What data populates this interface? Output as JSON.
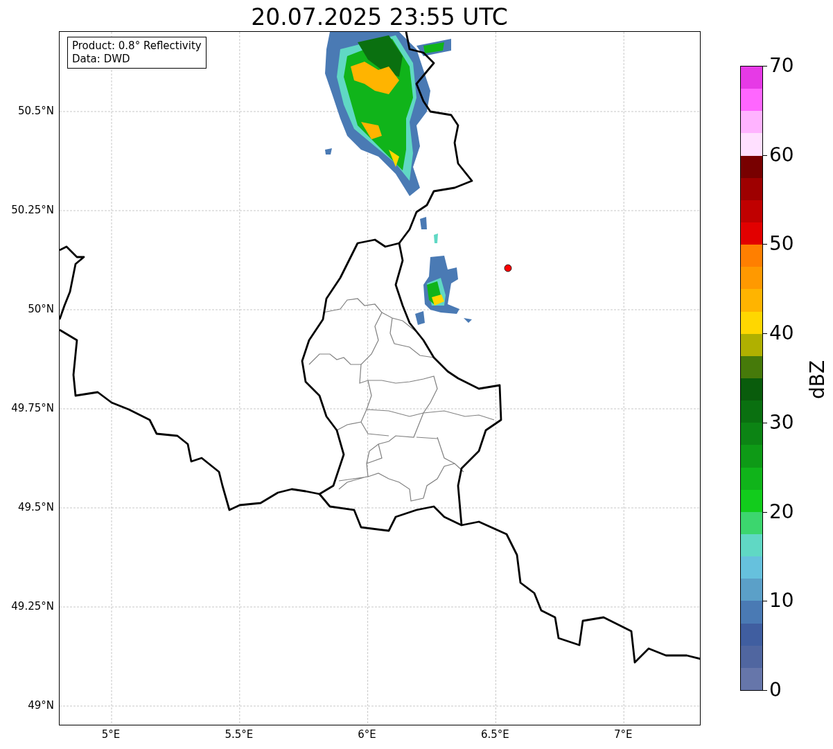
{
  "title": "20.07.2025 23:55 UTC",
  "info_box": [
    "Product: 0.8° Reflectivity",
    "Data: DWD"
  ],
  "map": {
    "y_labels": [
      "50.5°N",
      "50.25°N",
      "50°N",
      "49.75°N",
      "49.5°N",
      "49.25°N",
      "49°N"
    ],
    "x_labels": [
      "5°E",
      "5.5°E",
      "6°E",
      "6.5°E",
      "7°E"
    ]
  },
  "colorbar": {
    "label": "dBZ",
    "ticks": [
      "70",
      "60",
      "50",
      "40",
      "30",
      "20",
      "10",
      "0"
    ],
    "bins": [
      {
        "color": "#e63ae6"
      },
      {
        "color": "#ff66ff"
      },
      {
        "color": "#ffb3ff"
      },
      {
        "color": "#ffe0ff"
      },
      {
        "color": "#780000"
      },
      {
        "color": "#9e0000"
      },
      {
        "color": "#c00000"
      },
      {
        "color": "#e20000"
      },
      {
        "color": "#ff7f00"
      },
      {
        "color": "#ff9900"
      },
      {
        "color": "#ffb400"
      },
      {
        "color": "#ffd700"
      },
      {
        "color": "#b0b000"
      },
      {
        "color": "#467a0a"
      },
      {
        "color": "#095c0c"
      },
      {
        "color": "#0a7010"
      },
      {
        "color": "#0c8414"
      },
      {
        "color": "#0e9a16"
      },
      {
        "color": "#10b41a"
      },
      {
        "color": "#12cc1c"
      },
      {
        "color": "#3cd66e"
      },
      {
        "color": "#60d8c4"
      },
      {
        "color": "#66c1dd"
      },
      {
        "color": "#5ba0c8"
      },
      {
        "color": "#4a7ab4"
      },
      {
        "color": "#405ea0"
      },
      {
        "color": "#5066a0"
      },
      {
        "color": "#6676aa"
      }
    ]
  }
}
